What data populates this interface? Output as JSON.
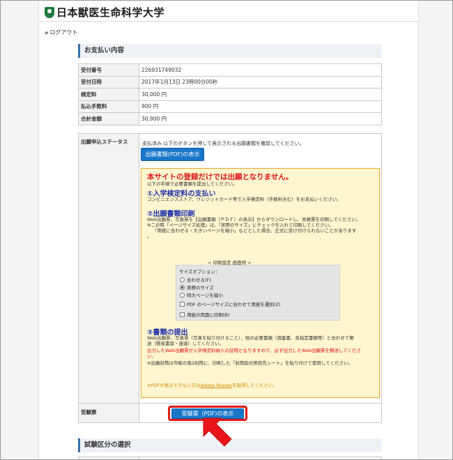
{
  "header": {
    "logo_text": "日本獣医生命科学大学",
    "logout_label": "ログアウト"
  },
  "payment": {
    "section_title": "お支払い内容",
    "rows": [
      {
        "label": "受付番号",
        "value": "226931749032"
      },
      {
        "label": "受付日時",
        "value": "2017年1月13日 23時00分00秒"
      },
      {
        "label": "検定料",
        "value": "30,000 円"
      },
      {
        "label": "払込手数料",
        "value": "900 円"
      },
      {
        "label": "合計金額",
        "value": "30,900 円"
      }
    ]
  },
  "status": {
    "label": "出願申込ステータス",
    "text": "支払済み 以下のボタンを押して表示される出願書類を確認してください。",
    "pdf_button": "出願書類(PDF)の表示"
  },
  "notice": {
    "title": "本サイトの登録だけでは出願となりません。",
    "intro": "以下の手順で必要書類を提出してください。",
    "step1_title": "①入学検定料の支払い",
    "step1_text": "コンビニエンスストア、クレジットカード等で入学検定料（手数料含む）をお支払いください。",
    "step2_title": "②出願書類印刷",
    "step2_line1": "Web出願票、写真票を【出願書類（ＰＤＦ）の表示】からダウンロードし、各帳票を印刷してください。",
    "step2_line2": "※この時「ページサイズ処理」は、「実際のサイズ」にチェックを入れて印刷してください。",
    "step2_line3": "「用紙に合わせる・大きいページを縮小」などとした場合、正式に受け付けられないことがあります",
    "step2_line4": "。",
    "print_caption": "< 印刷設定 画面例 >",
    "size_options_label": "サイズオプション：",
    "opt_fit": "合わせる(F)",
    "opt_actual": "実際のサイズ",
    "opt_shrink": "特大ページを縮小",
    "opt_pdf_paper": "PDF のページサイズに合わせて用紙を選択(Z)",
    "opt_duplex": "用紙の両面に印刷(B)",
    "step3_title": "③書類の提出",
    "step3_line1": "Web出願票、写真票（写真を貼り付けること）、他の必要書類（調査書、各指定書類等）と合わせて郵",
    "step3_line2": "送（簡易書留・速達）してください。",
    "step3_red1": "出力したWeb出願票が入学検定料納入の証明となりますので、必ず出力したWeb出願票を郵送してくださ",
    "step3_red2": "い。",
    "step3_line3": "※出願封筒は市販の角2封筒に、印刷した「封筒貼付用宛先シート」を貼り付けて使用してください。",
    "pdf_note_prefix": "※PDFが表示できない方は",
    "pdf_note_link": "Adobe Reader",
    "pdf_note_suffix": "を取得してください。"
  },
  "ticket": {
    "label": "受験票",
    "button": "受験票（PDF)の表示"
  },
  "exam_section": {
    "title": "試験区分の選択"
  },
  "colors": {
    "button_blue": "#1976c9",
    "highlight_red": "#e51515",
    "notice_bg": "#fff5cf",
    "logo_green": "#1c7a3e"
  }
}
